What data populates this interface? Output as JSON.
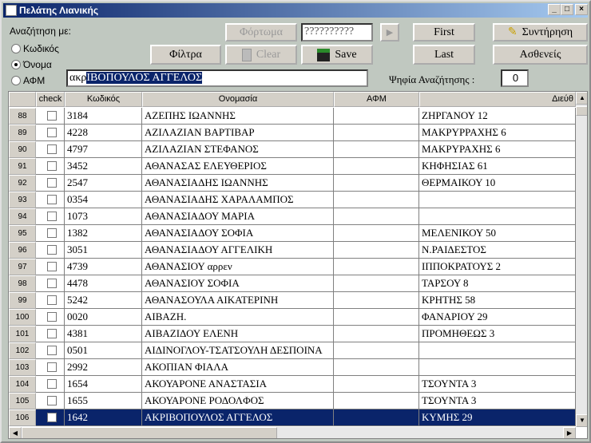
{
  "window": {
    "title": "Πελάτης Λιανικής",
    "min": "_",
    "max": "□",
    "close": "×"
  },
  "search": {
    "label": "Αναζήτηση με:",
    "options": [
      {
        "label": "Κωδικός",
        "selected": false
      },
      {
        "label": "Όνομα",
        "selected": true
      },
      {
        "label": "ΑΦΜ",
        "selected": false
      }
    ],
    "typed": "ακρ",
    "autocomplete": "ΙΒΟΠΟΥΛΟΣ ΑΓΓΕΛΟΣ",
    "digits_label": "Ψηφία Αναζήτησης :",
    "digits_value": "0"
  },
  "toolbar": {
    "load": "Φόρτωμα",
    "code_field": "??????????",
    "play": "▶",
    "first": "First",
    "maint": "Συντήρηση",
    "filters": "Φίλτρα",
    "clear": "Clear",
    "save": "Save",
    "last": "Last",
    "patients": "Ασθενείς"
  },
  "grid": {
    "columns": [
      "",
      "check",
      "Κωδικός",
      "Ονομασία",
      "ΑΦΜ",
      "Διεύθ"
    ],
    "rows": [
      {
        "n": "88",
        "code": "3184",
        "name": "ΑΖΕΠΗΣ ΙΩΑΝΝΗΣ",
        "afm": "",
        "addr": "ΖΗΡΓΑΝΟΥ 12"
      },
      {
        "n": "89",
        "code": "4228",
        "name": "ΑΖΙΛΑΖΙΑΝ ΒΑΡΤΙΒΑΡ",
        "afm": "",
        "addr": "ΜΑΚΡΥΡΡΑΧΗΣ 6"
      },
      {
        "n": "90",
        "code": "4797",
        "name": "ΑΖΙΛΑΖΙΑΝ ΣΤΕΦΑΝΟΣ",
        "afm": "",
        "addr": "ΜΑΚΡΥΡΑΧΗΣ 6"
      },
      {
        "n": "91",
        "code": "3452",
        "name": "ΑΘΑΝΑΣΑΣ ΕΛΕΥΘΕΡΙΟΣ",
        "afm": "",
        "addr": "ΚΗΦΗΣΙΑΣ 61"
      },
      {
        "n": "92",
        "code": "2547",
        "name": "ΑΘΑΝΑΣΙΑΔΗΣ  ΙΩΑΝΝΗΣ",
        "afm": "",
        "addr": "ΘΕΡΜΑΙΚΟΥ 10"
      },
      {
        "n": "93",
        "code": "0354",
        "name": "ΑΘΑΝΑΣΙΑΔΗΣ  ΧΑΡΑΛΑΜΠΟΣ",
        "afm": "",
        "addr": ""
      },
      {
        "n": "94",
        "code": "1073",
        "name": "ΑΘΑΝΑΣΙΑΔΟΥ  ΜΑΡΙΑ",
        "afm": "",
        "addr": ""
      },
      {
        "n": "95",
        "code": "1382",
        "name": "ΑΘΑΝΑΣΙΑΔΟΥ  ΣΟΦΙΑ",
        "afm": "",
        "addr": "ΜΕΛΕΝΙΚΟΥ  50"
      },
      {
        "n": "96",
        "code": "3051",
        "name": "ΑΘΑΝΑΣΙΑΔΟΥ ΑΓΓΕΛΙΚΗ",
        "afm": "",
        "addr": "Ν.ΡΑΙΔΕΣΤΟΣ"
      },
      {
        "n": "97",
        "code": "4739",
        "name": "ΑΘΑΝΑΣΙΟΥ αρρεν",
        "afm": "",
        "addr": "ΙΠΠΟΚΡΑΤΟΥΣ 2"
      },
      {
        "n": "98",
        "code": "4478",
        "name": "ΑΘΑΝΑΣΙΟΥ ΣΟΦΙΑ",
        "afm": "",
        "addr": "ΤΑΡΣΟΥ 8"
      },
      {
        "n": "99",
        "code": "5242",
        "name": "ΑΘΑΝΑΣΟΥΛΑ ΑΙΚΑΤΕΡΙΝΗ",
        "afm": "",
        "addr": "ΚΡΗΤΗΣ 58"
      },
      {
        "n": "100",
        "code": "0020",
        "name": "ΑΙΒΑΖΗ.",
        "afm": "",
        "addr": "ΦΑΝΑΡΙΟΥ  29"
      },
      {
        "n": "101",
        "code": "4381",
        "name": "ΑΙΒΑΖΙΔΟΥ ΕΛΕΝΗ",
        "afm": "",
        "addr": "ΠΡΟΜΗΘΕΩΣ 3"
      },
      {
        "n": "102",
        "code": "0501",
        "name": "ΑΙΔΙΝΟΓΛΟΥ-ΤΣΑΤΣΟΥΛΗ ΔΕΣΠΟΙΝΑ",
        "afm": "",
        "addr": ""
      },
      {
        "n": "103",
        "code": "2992",
        "name": "ΑΚΟΠΙΑΝ ΦΙΑΛΑ",
        "afm": "",
        "addr": ""
      },
      {
        "n": "104",
        "code": "1654",
        "name": "ΑΚΟΥΑΡΟΝΕ ΑΝΑΣΤΑΣΙΑ",
        "afm": "",
        "addr": "ΤΣΟΥΝΤΑ 3"
      },
      {
        "n": "105",
        "code": "1655",
        "name": "ΑΚΟΥΑΡΟΝΕ ΡΟΔΟΛΦΟΣ",
        "afm": "",
        "addr": "ΤΣΟΥΝΤΑ 3"
      },
      {
        "n": "106",
        "code": "1642",
        "name": "ΑΚΡΙΒΟΠΟΥΛΟΣ ΑΓΓΕΛΟΣ",
        "afm": "",
        "addr": "ΚΥΜΗΣ 29",
        "selected": true
      }
    ]
  },
  "colors": {
    "selection": "#0a246a",
    "window_bg": "#c0c8c0"
  }
}
